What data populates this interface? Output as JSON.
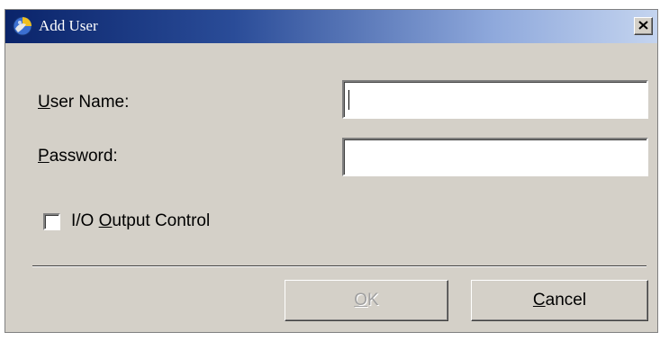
{
  "window": {
    "title": "Add User",
    "icon": "app-globe-icon",
    "close_icon": "close-x-icon"
  },
  "form": {
    "username": {
      "label": "User Name:",
      "mnemonic": "U",
      "label_rest": "ser Name:",
      "value": ""
    },
    "password": {
      "label": "Password:",
      "mnemonic": "P",
      "label_rest": "assword:",
      "value": ""
    },
    "io_output": {
      "label": "I/O Output Control",
      "label_pre": "I/O ",
      "mnemonic": "O",
      "label_rest": "utput Control",
      "checked": false
    }
  },
  "buttons": {
    "ok": {
      "label": "OK",
      "mnemonic": "O",
      "label_rest": "K",
      "enabled": false
    },
    "cancel": {
      "label": "Cancel",
      "mnemonic": "C",
      "label_rest": "ancel",
      "enabled": true
    }
  },
  "colors": {
    "dialog_bg": "#d4d0c8",
    "titlebar_start": "#0a246a",
    "titlebar_end": "#c4d4ef"
  }
}
